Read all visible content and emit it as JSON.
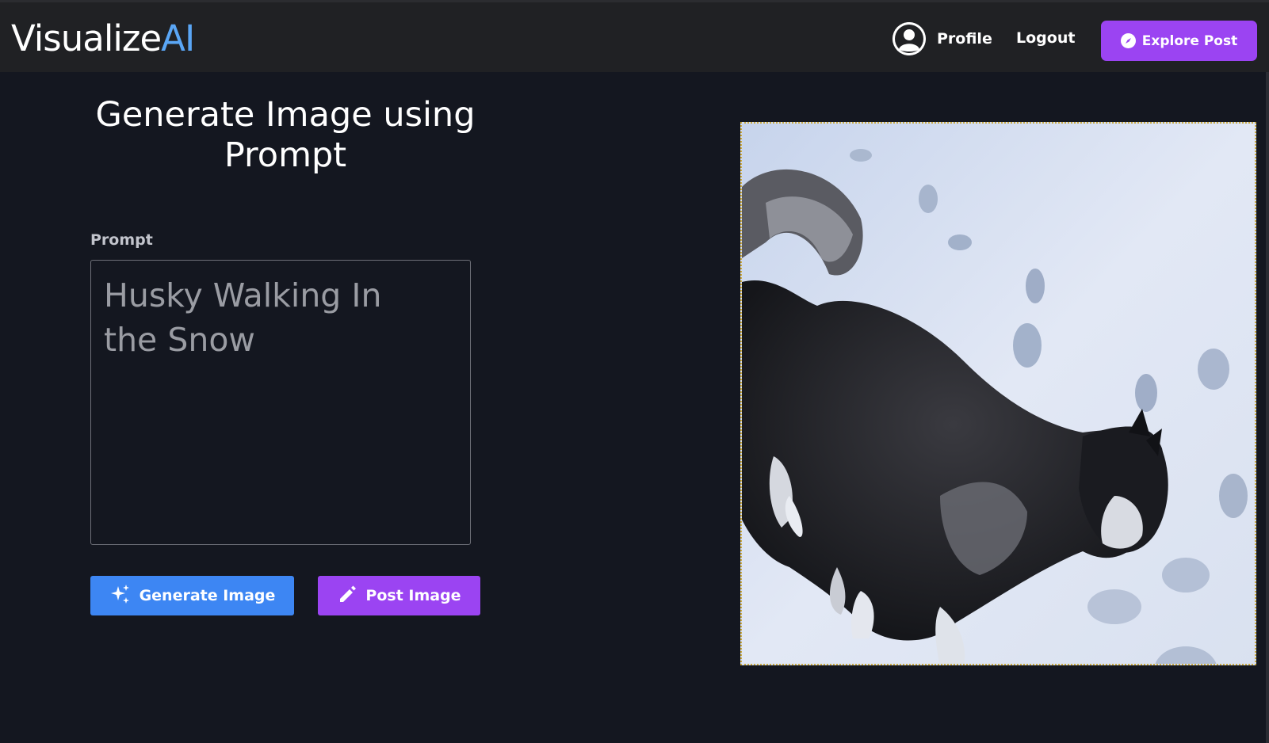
{
  "navbar": {
    "logo_main": "Visualize",
    "logo_accent": "AI",
    "profile_label": "Profile",
    "logout_label": "Logout",
    "explore_label": "Explore Post",
    "accent_color": "#5aa6f5",
    "button_color": "#9b44f2"
  },
  "main": {
    "title": "Generate Image using Prompt",
    "prompt_label": "Prompt",
    "prompt_value": "Husky Walking In the Snow",
    "generate_label": "Generate Image",
    "post_label": "Post Image",
    "generate_color": "#3d86f3",
    "post_color": "#9b44f2"
  },
  "preview": {
    "image_description_icon": "generated-image"
  },
  "icons": {
    "profile": "user-circle-icon",
    "explore": "compass-icon",
    "generate": "sparkles-icon",
    "post": "pencil-icon"
  }
}
